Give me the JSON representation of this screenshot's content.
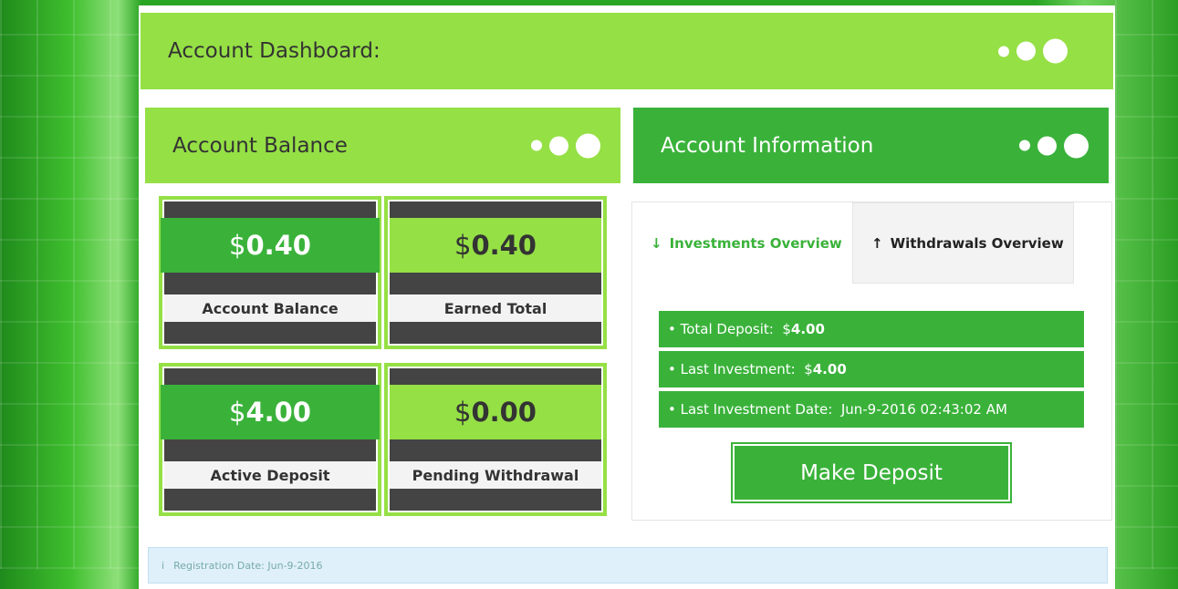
{
  "header": {
    "title": "Account Dashboard:"
  },
  "balance_panel": {
    "title": "Account Balance",
    "tiles": [
      {
        "currency": "$",
        "value": "0.40",
        "label": "Account Balance"
      },
      {
        "currency": "$",
        "value": "0.40",
        "label": "Earned Total"
      },
      {
        "currency": "$",
        "value": "4.00",
        "label": "Active Deposit"
      },
      {
        "currency": "$",
        "value": "0.00",
        "label": "Pending Withdrawal"
      }
    ]
  },
  "info_panel": {
    "title": "Account Information",
    "tabs": [
      {
        "label": "Investments Overview",
        "icon": "arrow-down-icon",
        "active": true
      },
      {
        "label": "Withdrawals Overview",
        "icon": "arrow-up-icon",
        "active": false
      }
    ],
    "rows": [
      {
        "label": "• Total Deposit:",
        "currency": "$",
        "value": "4.00"
      },
      {
        "label": "• Last Investment:",
        "currency": "$",
        "value": "4.00"
      },
      {
        "label": "• Last Investment Date:",
        "value": "Jun-9-2016 02:43:02 AM"
      }
    ],
    "deposit_button": "Make Deposit"
  },
  "alert": {
    "icon": "info-icon",
    "text": "Registration Date: Jun-9-2016"
  },
  "colors": {
    "dark_green": "#3ab23a",
    "light_green": "#95e045",
    "tile_dark": "#444444"
  }
}
